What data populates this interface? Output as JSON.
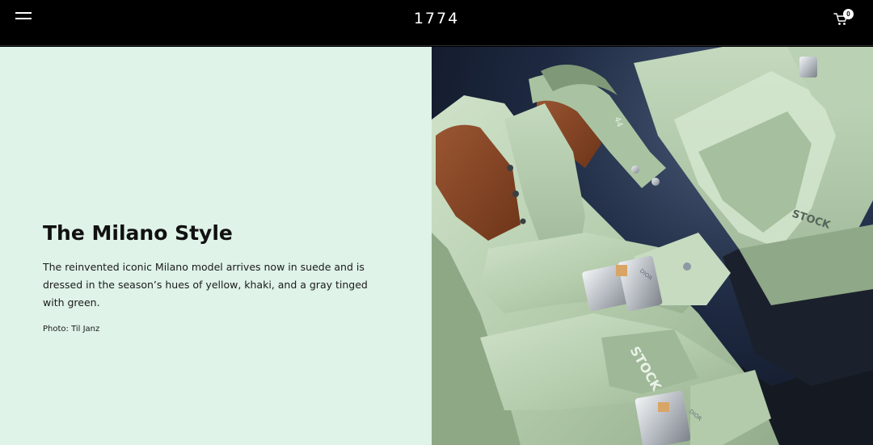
{
  "header": {
    "logo": "1774",
    "cart_count": "0",
    "menu_icon": "hamburger-menu-icon",
    "cart_icon": "shopping-cart-icon"
  },
  "feature": {
    "title": "The Milano Style",
    "description": "The reinvented iconic Milano model arrives now in suede and is dressed in the season’s hues of yellow, khaki, and a gray tinged with green.",
    "credit": "Photo: Til Janz",
    "image_alt": "Mint-green suede Milano sandals with metal buckles",
    "image_text": {
      "insole_brand": "STOCK",
      "buckle_brand": "DIOR",
      "size": "44"
    }
  },
  "colors": {
    "header_bg": "#000000",
    "panel_bg": "#dff3e8",
    "text": "#111111",
    "sandal": "#b7cfb0"
  }
}
